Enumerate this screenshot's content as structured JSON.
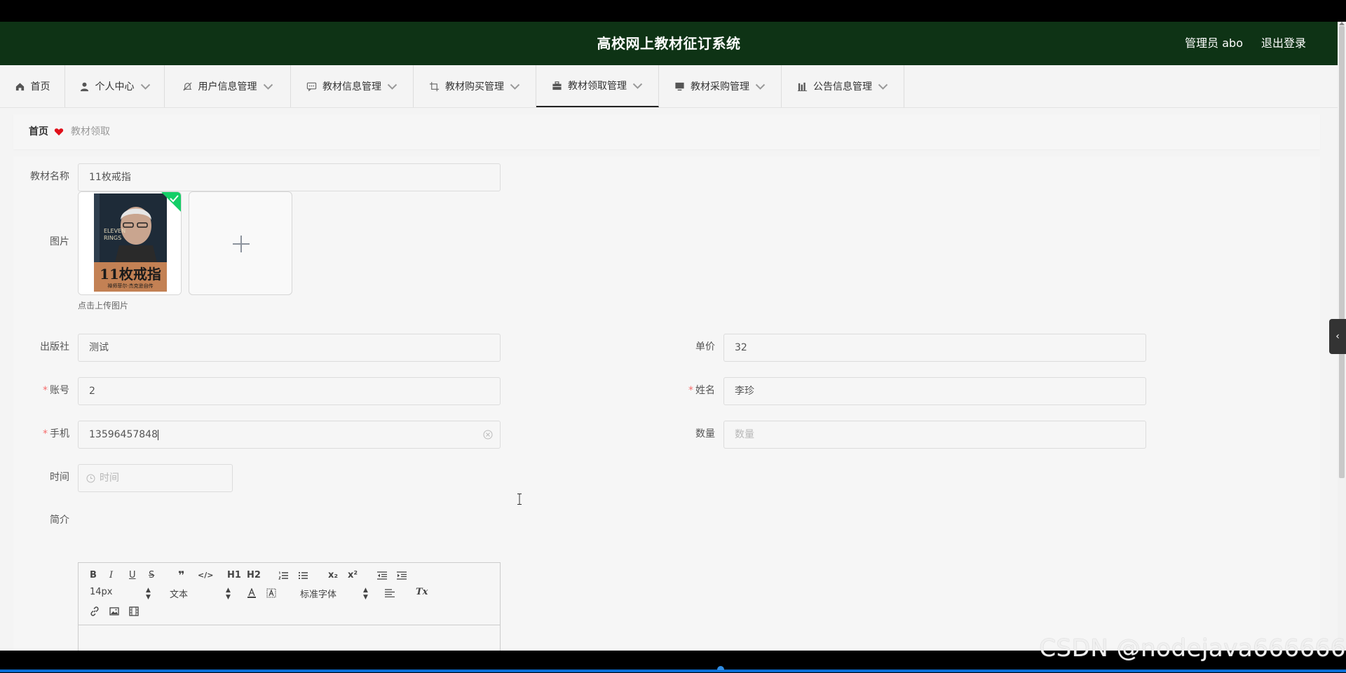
{
  "header": {
    "title": "高校网上教材征订系统",
    "user": "管理员 abo",
    "logout": "退出登录"
  },
  "nav": [
    {
      "label": "首页",
      "icon": "home-icon"
    },
    {
      "label": "个人中心",
      "icon": "user-icon"
    },
    {
      "label": "用户信息管理",
      "icon": "bell-off-icon"
    },
    {
      "label": "教材信息管理",
      "icon": "chat-icon"
    },
    {
      "label": "教材购买管理",
      "icon": "crop-icon"
    },
    {
      "label": "教材领取管理",
      "icon": "briefcase-icon",
      "active": true
    },
    {
      "label": "教材采购管理",
      "icon": "monitor-icon"
    },
    {
      "label": "公告信息管理",
      "icon": "chart-icon"
    }
  ],
  "breadcrumb": {
    "home": "首页",
    "current": "教材领取"
  },
  "form": {
    "name_label": "教材名称",
    "name_value": "11枚戒指",
    "image_label": "图片",
    "upload_hint": "点击上传图片",
    "book_cover": {
      "en": "ELEVEN RINGS",
      "cn": "11枚戒指",
      "sub": "禅师菲尔·杰克逊自传"
    },
    "publisher_label": "出版社",
    "publisher_value": "测试",
    "price_label": "单价",
    "price_value": "32",
    "account_label": "账号",
    "account_value": "2",
    "name2_label": "姓名",
    "name2_value": "李珍",
    "phone_label": "手机",
    "phone_value": "13596457848",
    "qty_label": "数量",
    "qty_placeholder": "数量",
    "time_label": "时间",
    "time_placeholder": "时间",
    "intro_label": "简介",
    "required_mark": "*"
  },
  "editor": {
    "font_size": "14px",
    "text_type": "文本",
    "font_family": "标准字体",
    "buttons": [
      "B",
      "I",
      "U",
      "S",
      "❞",
      "</>",
      "H1",
      "H2",
      "x₂",
      "x²",
      "Tx"
    ]
  },
  "watermark": "CSDN @nodejava666666",
  "colors": {
    "header_bg": "#0e3315",
    "required": "#f56c6c",
    "check_badge": "#13ce66"
  }
}
